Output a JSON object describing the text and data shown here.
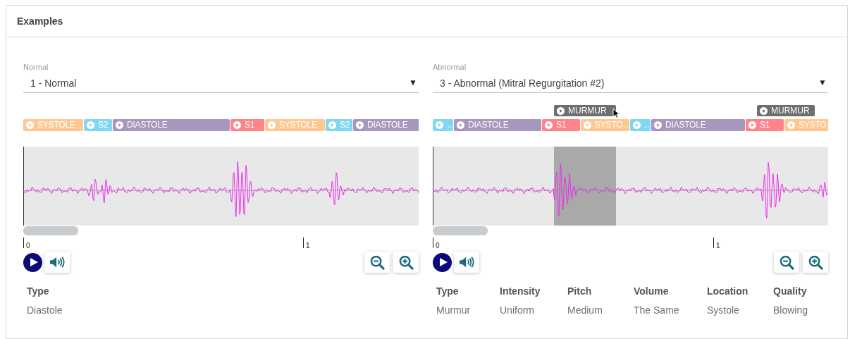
{
  "title": "Examples",
  "panels": [
    {
      "dropdown": {
        "label": "Normal",
        "value": "1 - Normal",
        "caret": "▼"
      },
      "segments": [
        {
          "kind": "systole",
          "label": "SYSTOLE"
        },
        {
          "kind": "s2",
          "label": "S2"
        },
        {
          "kind": "diastole",
          "label": "DIASTOLE"
        },
        {
          "kind": "s1",
          "label": "S1"
        },
        {
          "kind": "systole",
          "label": "SYSTOLE"
        },
        {
          "kind": "s2",
          "label": "S2"
        },
        {
          "kind": "diastole",
          "label": "DIASTOLE"
        }
      ],
      "ticks": [
        "0",
        "1"
      ],
      "info": [
        {
          "heading": "Type",
          "value": "Diastole"
        }
      ]
    },
    {
      "dropdown": {
        "label": "Abnormal",
        "value": "3 - Abnormal (Mitral Regurgitation #2)",
        "caret": "▼"
      },
      "segments": [
        {
          "kind": "s2",
          "label": "…"
        },
        {
          "kind": "diastole",
          "label": "DIASTOLE"
        },
        {
          "kind": "s1",
          "label": "S1"
        },
        {
          "kind": "systole",
          "label": "SYSTO…"
        },
        {
          "kind": "s2",
          "label": "…"
        },
        {
          "kind": "diastole",
          "label": "DIASTOLE"
        },
        {
          "kind": "s1",
          "label": "S1"
        },
        {
          "kind": "systole",
          "label": "SYSTO"
        }
      ],
      "murmurs": [
        {
          "label": "MURMUR",
          "hovered": true
        },
        {
          "label": "MURMUR",
          "hovered": false
        }
      ],
      "ticks": [
        "0",
        "1"
      ],
      "info": [
        {
          "heading": "Type",
          "value": "Murmur"
        },
        {
          "heading": "Intensity",
          "value": "Uniform"
        },
        {
          "heading": "Pitch",
          "value": "Medium"
        },
        {
          "heading": "Volume",
          "value": "The Same"
        },
        {
          "heading": "Location",
          "value": "Systole"
        },
        {
          "heading": "Quality",
          "value": "Blowing"
        }
      ]
    }
  ]
}
